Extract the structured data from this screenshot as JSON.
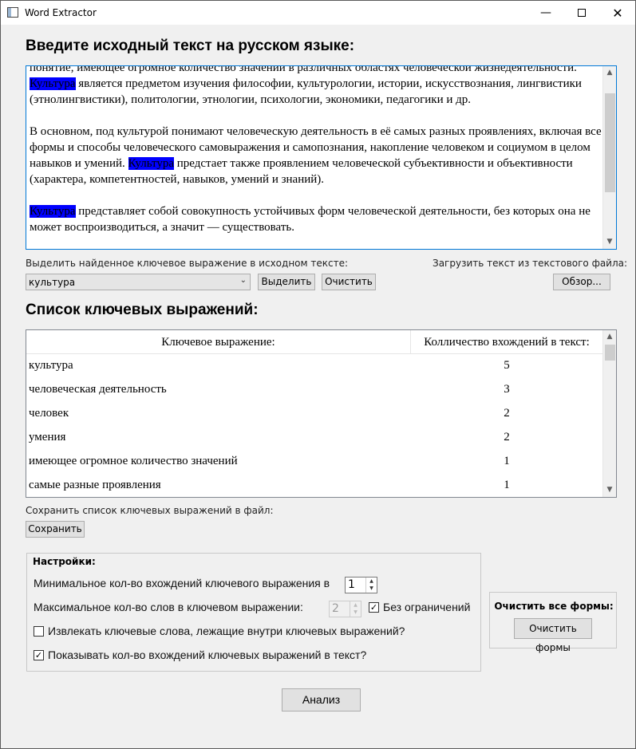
{
  "window": {
    "title": "Word Extractor",
    "minimize": "—",
    "close": "✕"
  },
  "source": {
    "heading": "Введите исходный текст на русском языке:",
    "line0": "понятие, имеющее огромное количество значений в различных областях человеческой",
    "p1_a": "жизнедеятельности. ",
    "p1_hl": "Культура",
    "p1_b": " является предметом изучения философии, культурологии, истории, искусствознания, лингвистики (этнолингвистики), политологии, этнологии, психологии, экономики, педагогики и др.",
    "p2_a": "В основном, под культурой понимают человеческую деятельность в её самых разных проявлениях, включая все формы и способы человеческого самовыражения и самопознания, накопление человеком и социумом в целом навыков и умений. ",
    "p2_hl": "Культура",
    "p2_b": " предстает также проявлением человеческой субъективности и объективности (характера, компетентностей, навыков, умений и знаний).",
    "p3_hl": "Культура",
    "p3_b": " представляет собой совокупность устойчивых форм человеческой деятельности, без которых она не может воспроизводиться, а значит — существовать."
  },
  "highlight": {
    "label": "Выделить найденное ключевое выражение в исходном тексте:",
    "selected": "культура",
    "select_button": "Выделить",
    "clear_button": "Очистить"
  },
  "load": {
    "label": "Загрузить текст из текстового файла:",
    "browse_button": "Обзор..."
  },
  "keywords": {
    "heading": "Список ключевых выражений:",
    "col_phrase": "Ключевое выражение:",
    "col_count": "Колличество вхождений в текст:",
    "rows": [
      {
        "phrase": "культура",
        "count": "5"
      },
      {
        "phrase": "человеческая деятельность",
        "count": "3"
      },
      {
        "phrase": "человек",
        "count": "2"
      },
      {
        "phrase": "умения",
        "count": "2"
      },
      {
        "phrase": "имеющее огромное количество значений",
        "count": "1"
      },
      {
        "phrase": "самые разные проявления",
        "count": "1"
      }
    ]
  },
  "save": {
    "label": "Сохранить список ключевых выражений в файл:",
    "button": "Сохранить"
  },
  "settings": {
    "title": "Настройки:",
    "min_label": "Минимальное кол-во вхождений ключевого выражения в",
    "min_value": "1",
    "max_label": "Максимальное кол-во слов в ключевом выражении:",
    "max_value": "2",
    "unlimited_label": "Без ограничений",
    "unlimited_checked": true,
    "nested_label": "Извлекать ключевые слова, лежащие внутри ключевых выражений?",
    "nested_checked": false,
    "show_count_label": "Показывать кол-во вхождений ключевых выражений в текст?",
    "show_count_checked": true
  },
  "clear_all": {
    "title": "Очистить все формы:",
    "button": "Очистить формы"
  },
  "analyze_button": "Анализ",
  "icons": {
    "app": "app-window-icon",
    "checkmark": "✓"
  }
}
